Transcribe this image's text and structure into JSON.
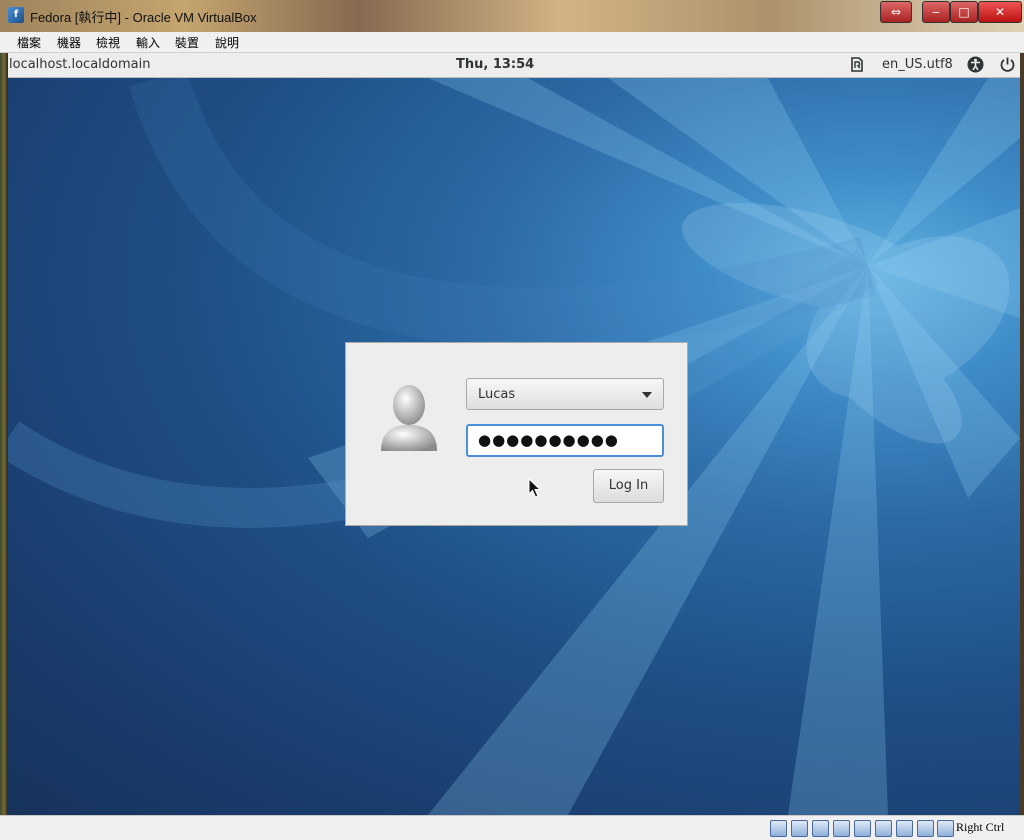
{
  "window": {
    "title": "Fedora [執行中] - Oracle VM VirtualBox",
    "icon_text": "f"
  },
  "menu": {
    "items": [
      "檔案",
      "機器",
      "檢視",
      "輸入",
      "裝置",
      "說明"
    ]
  },
  "topbar": {
    "hostname": "localhost.localdomain",
    "clock": "Thu, 13:54",
    "locale": "en_US.utf8"
  },
  "login": {
    "username": "Lucas",
    "password_masked": "●●●●●●●●●●",
    "login_button": "Log In"
  },
  "statusbar": {
    "host_key": "Right Ctrl"
  },
  "colors": {
    "focus_blue": "#4a90d9",
    "desktop_dark": "#1a3d6e",
    "desktop_light": "#5fb0e0"
  }
}
